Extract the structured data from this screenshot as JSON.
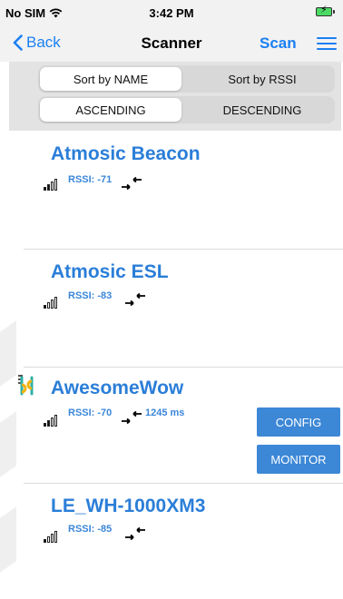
{
  "status_bar": {
    "carrier": "No SIM",
    "time": "3:42 PM"
  },
  "nav": {
    "back_label": "Back",
    "title": "Scanner",
    "scan_label": "Scan"
  },
  "sort": {
    "by_name": "Sort by NAME",
    "by_rssi": "Sort by RSSI",
    "ascending": "ASCENDING",
    "descending": "DESCENDING",
    "selected_sort": "Sort by NAME",
    "selected_order": "ASCENDING"
  },
  "devices": [
    {
      "name": "Atmosic Beacon",
      "rssi": "RSSI: -71",
      "timing": "",
      "signal_bars": 2
    },
    {
      "name": "Atmosic ESL",
      "rssi": "RSSI: -83",
      "timing": "",
      "signal_bars": 1
    },
    {
      "name": "AwesomeWow",
      "rssi": "RSSI: -70",
      "timing": "1245 ms",
      "signal_bars": 2,
      "connected": true,
      "config_label": "CONFIG",
      "monitor_label": "MONITOR"
    },
    {
      "name": "LE_WH-1000XM3",
      "rssi": "RSSI: -85",
      "timing": "",
      "signal_bars": 1
    }
  ],
  "icons": {
    "back": "chevron-left-icon",
    "menu": "hamburger-menu-icon",
    "signal": "signal-strength-icon",
    "arrows": "connectable-arrows-icon",
    "connected": "sliders-icon"
  },
  "colors": {
    "accent": "#1a7ff2",
    "device_name": "#2a7ed8",
    "button": "#3c87d6",
    "connected_icon_a": "#f2b20c",
    "connected_icon_b": "#2fb0a8"
  }
}
